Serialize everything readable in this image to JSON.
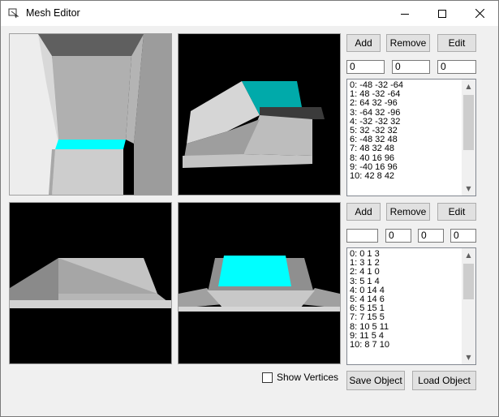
{
  "window": {
    "title": "Mesh Editor"
  },
  "icons": {
    "app": "mesh-app-icon",
    "minimize": "minimize-icon",
    "maximize": "maximize-icon",
    "close": "close-icon"
  },
  "vertex_panel": {
    "add_label": "Add",
    "remove_label": "Remove",
    "edit_label": "Edit",
    "fields": [
      "0",
      "0",
      "0"
    ],
    "items": [
      "0: -48 -32 -64",
      "1: 48 -32 -64",
      "2: 64 32 -96",
      "3: -64 32 -96",
      "4: -32 -32 32",
      "5: 32 -32 32",
      "6: -48 32 48",
      "7: 48 32 48",
      "8: 40 16 96",
      "9: -40 16 96",
      "10: 42 8 42"
    ]
  },
  "face_panel": {
    "add_label": "Add",
    "remove_label": "Remove",
    "edit_label": "Edit",
    "fields": [
      "",
      "0",
      "0",
      "0"
    ],
    "items": [
      "0: 0 1 3",
      "1: 3 1 2",
      "2: 4 1 0",
      "3: 5 1 4",
      "4: 0 14 4",
      "5: 4 14 6",
      "6: 5 15 1",
      "7: 7 15 5",
      "8: 10 5 11",
      "9: 11 5 4",
      "10: 8 7 10"
    ]
  },
  "show_vertices": {
    "label": "Show Vertices",
    "checked": false
  },
  "save_label": "Save Object",
  "load_label": "Load Object",
  "colors": {
    "highlight": "#00ffff",
    "teal": "#00aaaa",
    "viewport_bg": "#000000"
  }
}
